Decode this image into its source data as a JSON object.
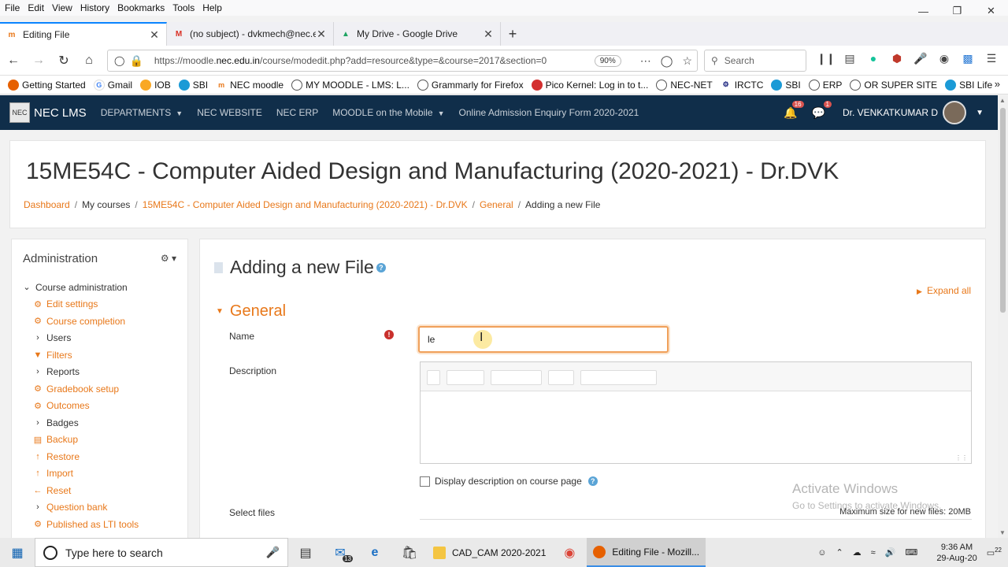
{
  "menubar": [
    "File",
    "Edit",
    "View",
    "History",
    "Bookmarks",
    "Tools",
    "Help"
  ],
  "tabs": [
    {
      "title": "Editing File",
      "icon": "moodle-icon"
    },
    {
      "title": "(no subject) - dvkmech@nec.e",
      "icon": "gmail-icon"
    },
    {
      "title": "My Drive - Google Drive",
      "icon": "drive-icon"
    }
  ],
  "urlbar": {
    "url_host": "https://moodle.",
    "url_domain": "nec.edu.in",
    "url_path": "/course/modedit.php?add=resource&type=&course=2017&section=0",
    "zoom": "90%",
    "search_placeholder": "Search"
  },
  "bookmarks": [
    "Getting Started",
    "Gmail",
    "IOB",
    "SBI",
    "NEC moodle",
    "MY MOODLE - LMS: L...",
    "Grammarly for Firefox",
    "Pico Kernel: Log in to t...",
    "NEC-NET",
    "IRCTC",
    "SBI",
    "ERP",
    "OR SUPER SITE",
    "SBI Life"
  ],
  "moodle_nav": {
    "brand": "NEC LMS",
    "links": [
      "DEPARTMENTS",
      "NEC WEBSITE",
      "NEC ERP",
      "MOODLE on the Mobile",
      "Online Admission Enquiry Form 2020-2021"
    ],
    "notification_count": "16",
    "message_count": "1",
    "user_name": "Dr. VENKATKUMAR D"
  },
  "course_title": "15ME54C - Computer Aided Design and Manufacturing (2020-2021) - Dr.DVK",
  "breadcrumb": [
    "Dashboard",
    "My courses",
    "15ME54C - Computer Aided Design and Manufacturing (2020-2021) - Dr.DVK",
    "General",
    "Adding a new File"
  ],
  "admin": {
    "title": "Administration",
    "section": "Course administration",
    "items": [
      {
        "label": "Edit settings",
        "type": "gear"
      },
      {
        "label": "Course completion",
        "type": "gear"
      },
      {
        "label": "Users",
        "type": "expand"
      },
      {
        "label": "Filters",
        "type": "filter"
      },
      {
        "label": "Reports",
        "type": "expand"
      },
      {
        "label": "Gradebook setup",
        "type": "gear"
      },
      {
        "label": "Outcomes",
        "type": "gear"
      },
      {
        "label": "Badges",
        "type": "expand"
      },
      {
        "label": "Backup",
        "type": "backup"
      },
      {
        "label": "Restore",
        "type": "restore"
      },
      {
        "label": "Import",
        "type": "import"
      },
      {
        "label": "Reset",
        "type": "reset"
      },
      {
        "label": "Question bank",
        "type": "expand"
      },
      {
        "label": "Published as LTI tools",
        "type": "gear"
      }
    ]
  },
  "form": {
    "page_title": "Adding a new File",
    "expand_all": "Expand all",
    "section": "General",
    "name_label": "Name",
    "name_value": "le",
    "description_label": "Description",
    "display_description": "Display description on course page",
    "select_files_label": "Select files",
    "max_size": "Maximum size for new files: 20MB"
  },
  "watermark": {
    "title": "Activate Windows",
    "subtitle": "Go to Settings to activate Windows."
  },
  "taskbar": {
    "search_placeholder": "Type here to search",
    "mail_count": "13",
    "apps": [
      "CAD_CAM 2020-2021",
      "Editing File - Mozill..."
    ],
    "time": "9:36 AM",
    "date": "29-Aug-20",
    "notification_count": "22"
  }
}
